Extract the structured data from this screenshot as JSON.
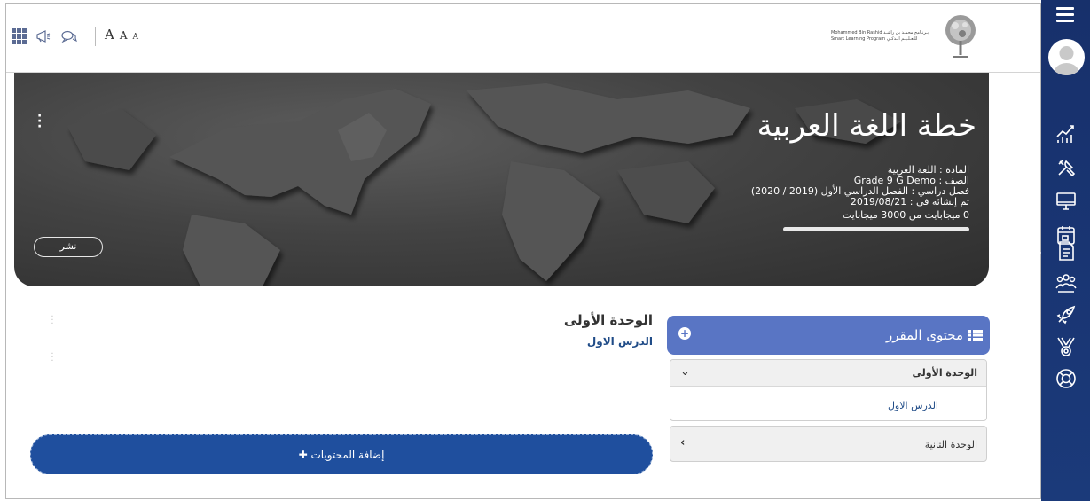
{
  "topbar": {
    "icons": [
      "apps-grid-icon",
      "megaphone-icon",
      "chat-bubbles-icon"
    ],
    "font_sizes": [
      "A",
      "A",
      "A"
    ],
    "logo": {
      "line1": "Mohammed Bin Rashid بـرنـامج محمـد بن راشـد",
      "line2": "Smart Learning Program للتعـلـيـم الـذكـي"
    }
  },
  "hero": {
    "title": "خطة اللغة العربية",
    "subject": "المادة : اللغة العربية",
    "grade": "الصف : Grade 9 G Demo",
    "semester": "فصل دراسي : الفصل الدراسي الأول (2019 / 2020)",
    "created": "تم إنشائه في : 2019/08/21",
    "storage_text": "0 ميجابايت من 3000 ميجابايت",
    "storage_used_fraction": 0,
    "publish_label": "نشر"
  },
  "main": {
    "unit_title": "الوحدة الأولى",
    "lesson_link": "الدرس الاول",
    "add_content_label": "✚ إضافة المحتويات"
  },
  "course_panel": {
    "title": "محتوى المقرر",
    "units": [
      {
        "label": "الوحدة الأولى",
        "expanded": true,
        "lessons": [
          "الدرس الاول"
        ]
      },
      {
        "label": "الوحدة الثانية",
        "expanded": false
      }
    ]
  },
  "sidebar": {
    "items": [
      "menu-icon",
      "user-avatar",
      "reports-icon",
      "tools-icon",
      "monitor-icon",
      "calendar-icon",
      "document-icon",
      "users-group-icon",
      "rocket-icon",
      "medal-icon",
      "help-lifebuoy-icon"
    ],
    "active": "document-icon"
  },
  "colors": {
    "sidebar": "#1b3a7a",
    "panel_header": "#5975c4",
    "add_button": "#1f4f9e",
    "link": "#1f4b87"
  }
}
